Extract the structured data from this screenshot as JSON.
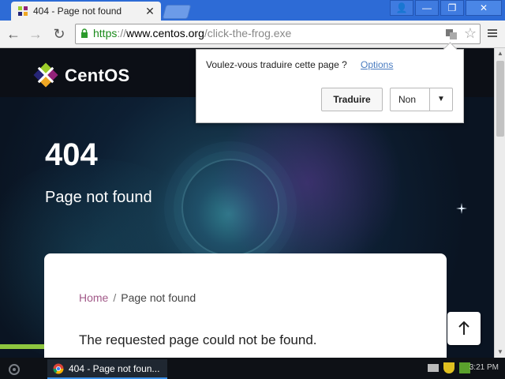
{
  "tab": {
    "title": "404 - Page not found",
    "close": "✕"
  },
  "window_buttons": {
    "user": "👤",
    "minimize": "—",
    "restore": "❐",
    "close": "✕"
  },
  "nav": {
    "back": "←",
    "forward": "→",
    "reload": "↻"
  },
  "omnibox": {
    "scheme": "https",
    "separator": "://",
    "host": "www.centos.org",
    "path": "/click-the-frog.exe"
  },
  "page": {
    "brand": "CentOS",
    "error_code": "404",
    "error_title": "Page not found",
    "breadcrumb": {
      "home": "Home",
      "separator": "/",
      "current": "Page not found"
    },
    "message": "The requested page could not be found."
  },
  "translate_bar": {
    "question": "Voulez-vous traduire cette page ?",
    "options_link": "Options",
    "translate_button": "Traduire",
    "decline_button": "Non"
  },
  "taskbar": {
    "item_label": "404 - Page not foun...",
    "clock": "3:21 PM"
  },
  "colors": {
    "chrome_blue": "#2d6bd6",
    "breadcrumb_link": "#a25a89",
    "accent_green": "#8ec63f"
  }
}
